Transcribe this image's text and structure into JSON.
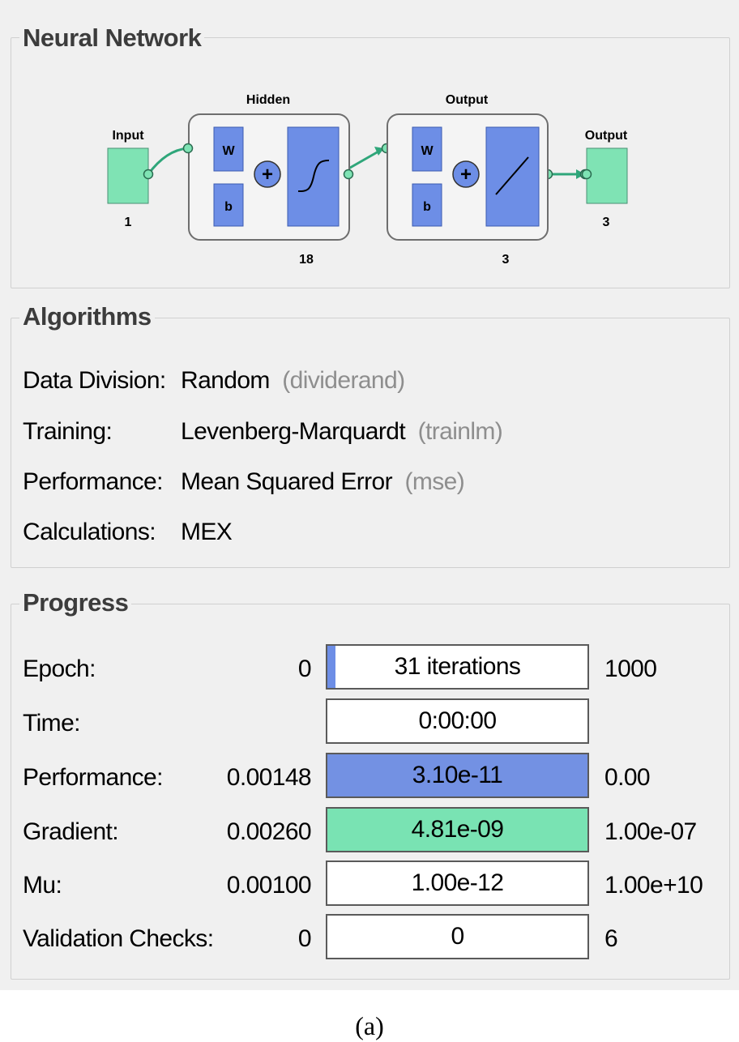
{
  "neural_network": {
    "title": "Neural Network",
    "input_label": "Input",
    "input_size": "1",
    "hidden_label": "Hidden",
    "hidden_size": "18",
    "output_layer_label": "Output",
    "output_layer_size": "3",
    "output_label": "Output",
    "output_size": "3",
    "weight_symbol": "W",
    "bias_symbol": "b",
    "sum_symbol": "+",
    "colors": {
      "node": "#7fe3b4",
      "block": "#6d8ee6",
      "connector": "#2fa67a"
    }
  },
  "algorithms": {
    "title": "Algorithms",
    "rows": [
      {
        "label": "Data Division:",
        "value": "Random",
        "detail": "(dividerand)"
      },
      {
        "label": "Training:",
        "value": "Levenberg-Marquardt",
        "detail": "(trainlm)"
      },
      {
        "label": "Performance:",
        "value": "Mean Squared Error",
        "detail": "(mse)"
      },
      {
        "label": "Calculations:",
        "value": "MEX",
        "detail": ""
      }
    ]
  },
  "progress": {
    "title": "Progress",
    "rows": [
      {
        "label": "Epoch:",
        "min": "0",
        "bar_text": "31 iterations",
        "max": "1000",
        "fill": 0.031,
        "fill_color": "#6d8ee6"
      },
      {
        "label": "Time:",
        "min": "",
        "bar_text": "0:00:00",
        "max": "",
        "fill": 0,
        "fill_color": "#ffffff"
      },
      {
        "label": "Performance:",
        "min": "0.00148",
        "bar_text": "3.10e-11",
        "max": "0.00",
        "fill": 1,
        "fill_color": "#7391e3"
      },
      {
        "label": "Gradient:",
        "min": "0.00260",
        "bar_text": "4.81e-09",
        "max": "1.00e-07",
        "fill": 1,
        "fill_color": "#79e3b3"
      },
      {
        "label": "Mu:",
        "min": "0.00100",
        "bar_text": "1.00e-12",
        "max": "1.00e+10",
        "fill": 0,
        "fill_color": "#ffffff"
      },
      {
        "label": "Validation Checks:",
        "min": "0",
        "bar_text": "0",
        "max": "6",
        "fill": 0,
        "fill_color": "#ffffff"
      }
    ]
  },
  "caption": "(a)"
}
